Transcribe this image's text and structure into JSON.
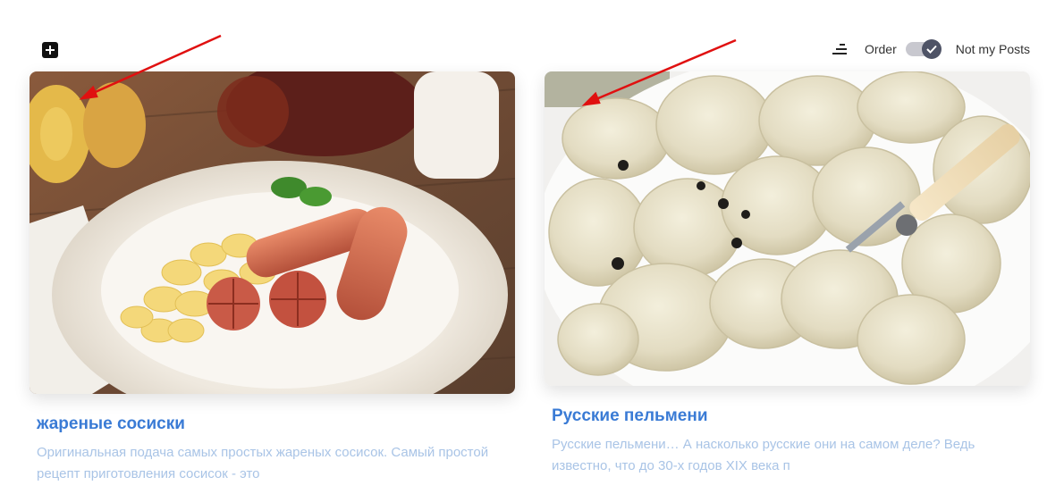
{
  "toolbar": {
    "add_icon": "plus-square-icon",
    "sort_icon": "sort-lines-icon",
    "order_label": "Order",
    "order_toggle_on": true,
    "not_my_posts_label": "Not my Posts"
  },
  "cards": [
    {
      "title": "жареные сосиски",
      "description": "Оригинальная подача самых простых жареных сосисок. Самый простой рецепт приготовления сосисок - это",
      "image_subject": "plate-with-fried-sausages-and-pasta"
    },
    {
      "title": "Русские пельмени",
      "description": "Русские пельмени… А насколько русские они на самом деле? Ведь известно, что до 30-х годов XIX века п",
      "image_subject": "plate-with-pelmeni-dumplings-and-fork"
    }
  ],
  "colors": {
    "title": "#3a7bd5",
    "description": "#a9c4e6",
    "annotation_arrow": "#e01010"
  }
}
